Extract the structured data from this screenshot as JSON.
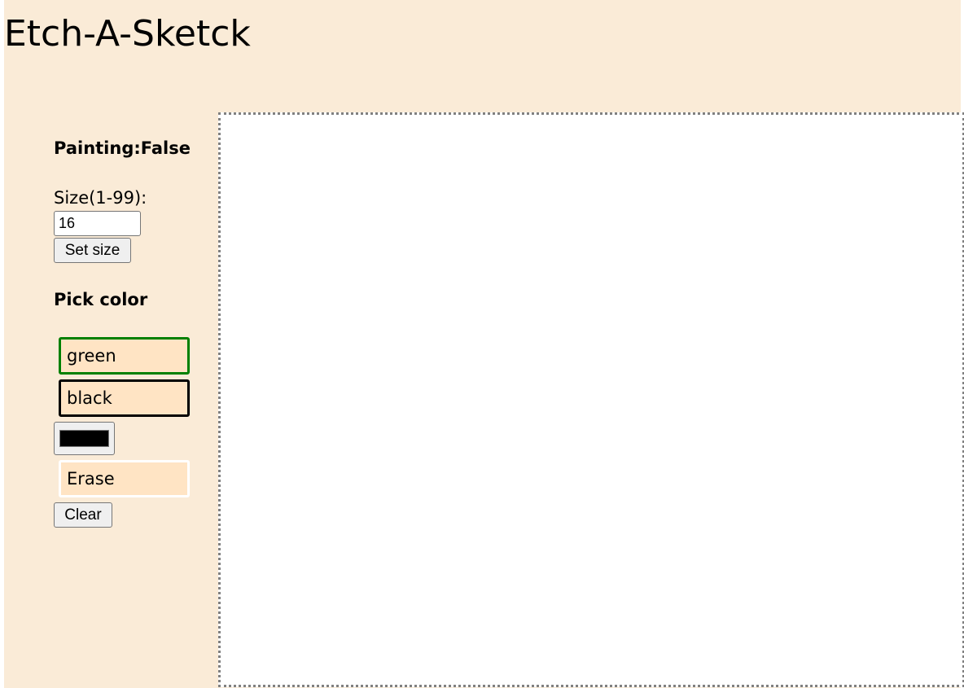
{
  "app": {
    "title": "Etch-A-Sketck"
  },
  "sidebar": {
    "painting_status": "Painting:False",
    "size_label": "Size(1-99):",
    "size_value": "16",
    "set_size_label": "Set size",
    "pick_color_heading": "Pick color",
    "color_buttons": [
      {
        "label": "green",
        "border_color": "#008000"
      },
      {
        "label": "black",
        "border_color": "#000000"
      }
    ],
    "color_picker_value": "#000000",
    "erase_label": "Erase",
    "clear_label": "Clear"
  },
  "colors": {
    "page_background": "#faebd7",
    "button_background": "#ffe4c4",
    "canvas_background": "#ffffff",
    "canvas_border": "#808080"
  }
}
